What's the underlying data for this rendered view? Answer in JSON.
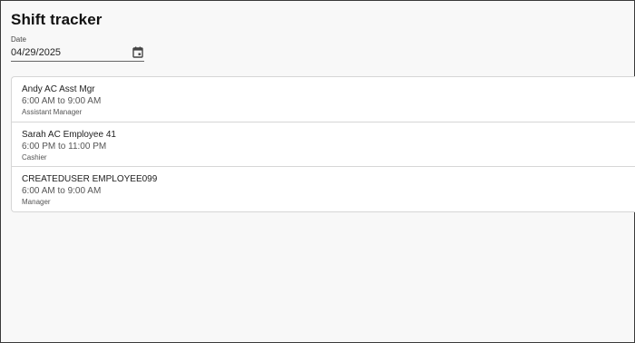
{
  "page": {
    "title": "Shift tracker"
  },
  "date_field": {
    "label": "Date",
    "value": "04/29/2025",
    "icon": "calendar-icon"
  },
  "shifts": [
    {
      "name": "Andy AC Asst Mgr",
      "time": "6:00 AM to 9:00 AM",
      "role": "Assistant Manager"
    },
    {
      "name": "Sarah AC Employee 41",
      "time": "6:00 PM to 11:00 PM",
      "role": "Cashier"
    },
    {
      "name": "CREATEDUSER EMPLOYEE099",
      "time": "6:00 AM to 9:00 AM",
      "role": "Manager"
    }
  ]
}
